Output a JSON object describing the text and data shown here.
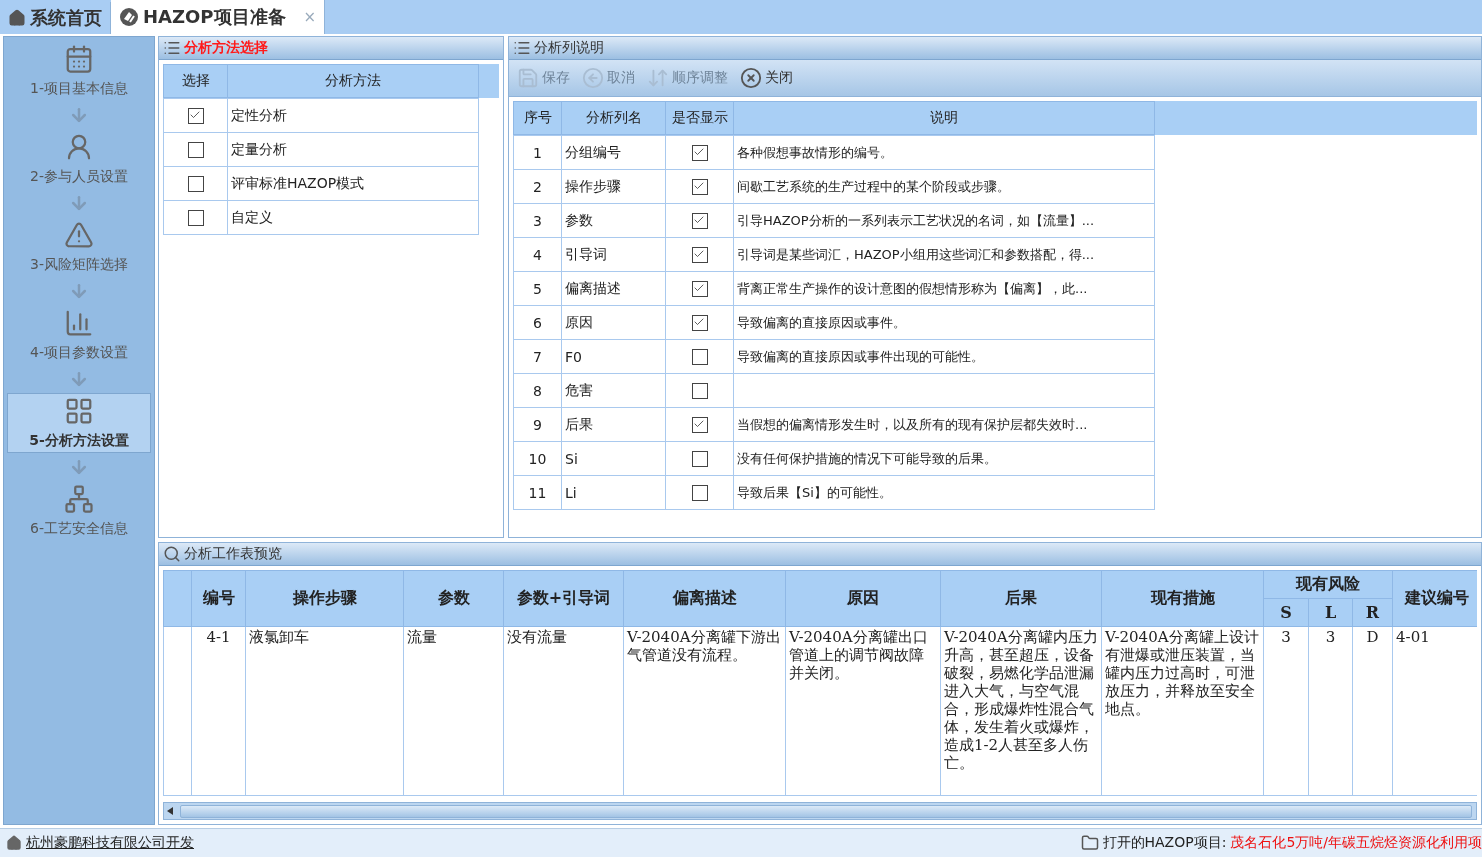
{
  "tabs": [
    {
      "label": "系统首页",
      "selected": false
    },
    {
      "label": "HAZOP项目准备",
      "selected": true,
      "close": "×"
    }
  ],
  "sidebar": {
    "steps": [
      {
        "label": "1-项目基本信息",
        "selected": false
      },
      {
        "label": "2-参与人员设置",
        "selected": false
      },
      {
        "label": "3-风险矩阵选择",
        "selected": false
      },
      {
        "label": "4-项目参数设置",
        "selected": false
      },
      {
        "label": "5-分析方法设置",
        "selected": true
      },
      {
        "label": "6-工艺安全信息",
        "selected": false
      }
    ]
  },
  "method_panel": {
    "title": "分析方法选择",
    "active": true,
    "columns": [
      "选择",
      "分析方法"
    ],
    "rows": [
      {
        "name": "定性分析",
        "checked": true
      },
      {
        "name": "定量分析",
        "checked": false
      },
      {
        "name": "评审标准HAZOP模式",
        "checked": false
      },
      {
        "name": "自定义",
        "checked": false
      }
    ]
  },
  "column_panel": {
    "title": "分析列说明",
    "active": false,
    "toolbar": [
      {
        "label": "保存",
        "disabled": true
      },
      {
        "label": "取消",
        "disabled": true
      },
      {
        "label": "顺序调整",
        "disabled": true
      },
      {
        "label": "关闭",
        "disabled": false
      }
    ],
    "columns": [
      "序号",
      "分析列名",
      "是否显示",
      "说明"
    ],
    "rows": [
      {
        "no": "1",
        "name": "分组编号",
        "shown": true,
        "desc": "各种假想事故情形的编号。"
      },
      {
        "no": "2",
        "name": "操作步骤",
        "shown": true,
        "desc": "间歇工艺系统的生产过程中的某个阶段或步骤。"
      },
      {
        "no": "3",
        "name": "参数",
        "shown": true,
        "desc": "引导HAZOP分析的一系列表示工艺状况的名词，如【流量】..."
      },
      {
        "no": "4",
        "name": "引导词",
        "shown": true,
        "desc": "引导词是某些词汇，HAZOP小组用这些词汇和参数搭配，得..."
      },
      {
        "no": "5",
        "name": "偏离描述",
        "shown": true,
        "desc": "背离正常生产操作的设计意图的假想情形称为【偏离】，此..."
      },
      {
        "no": "6",
        "name": "原因",
        "shown": true,
        "desc": "导致偏离的直接原因或事件。"
      },
      {
        "no": "7",
        "name": "F0",
        "shown": false,
        "desc": "导致偏离的直接原因或事件出现的可能性。"
      },
      {
        "no": "8",
        "name": "危害",
        "shown": false
      },
      {
        "no": "9",
        "name": "后果",
        "shown": true,
        "desc": "当假想的偏离情形发生时，以及所有的现有保护层都失效时..."
      },
      {
        "no": "10",
        "name": "Si",
        "shown": false,
        "desc": "没有任何保护措施的情况下可能导致的后果。"
      },
      {
        "no": "11",
        "name": "Li",
        "shown": false,
        "desc": "导致后果【Si】的可能性。"
      }
    ]
  },
  "preview_panel": {
    "title": "分析工作表预览",
    "active": false,
    "columns": [
      "编号",
      "操作步骤",
      "参数",
      "参数+引导词",
      "偏离描述",
      "原因",
      "后果",
      "现有措施"
    ],
    "group_header": "现有风险",
    "group_columns": [
      "S",
      "L",
      "R"
    ],
    "last_column": "建议编号",
    "rows": [
      {
        "cells": [
          "4-1",
          "液氯卸车",
          "流量",
          "没有流量",
          "V-2040A分离罐下游出气管道没有流程。",
          "V-2040A分离罐出口管道上的调节阀故障并关闭。",
          "V-2040A分离罐内压力升高，甚至超压，设备破裂，易燃化学品泄漏进入大气，与空气混合，形成爆炸性混合气体，发生着火或爆炸，造成1-2人甚至多人伤亡。",
          "V-2040A分离罐上设计有泄爆或泄压装置，当罐内压力过高时，可泄放压力，并释放至安全地点。"
        ],
        "risk": [
          "3",
          "3",
          "D"
        ],
        "suggestion": "4-01"
      }
    ]
  },
  "status_bar": {
    "company": "杭州豪鹏科技有限公司开发",
    "project_label": "打开的HAZOP项目:",
    "project_name": "茂名石化5万吨/年碳五烷烃资源化利用项"
  }
}
